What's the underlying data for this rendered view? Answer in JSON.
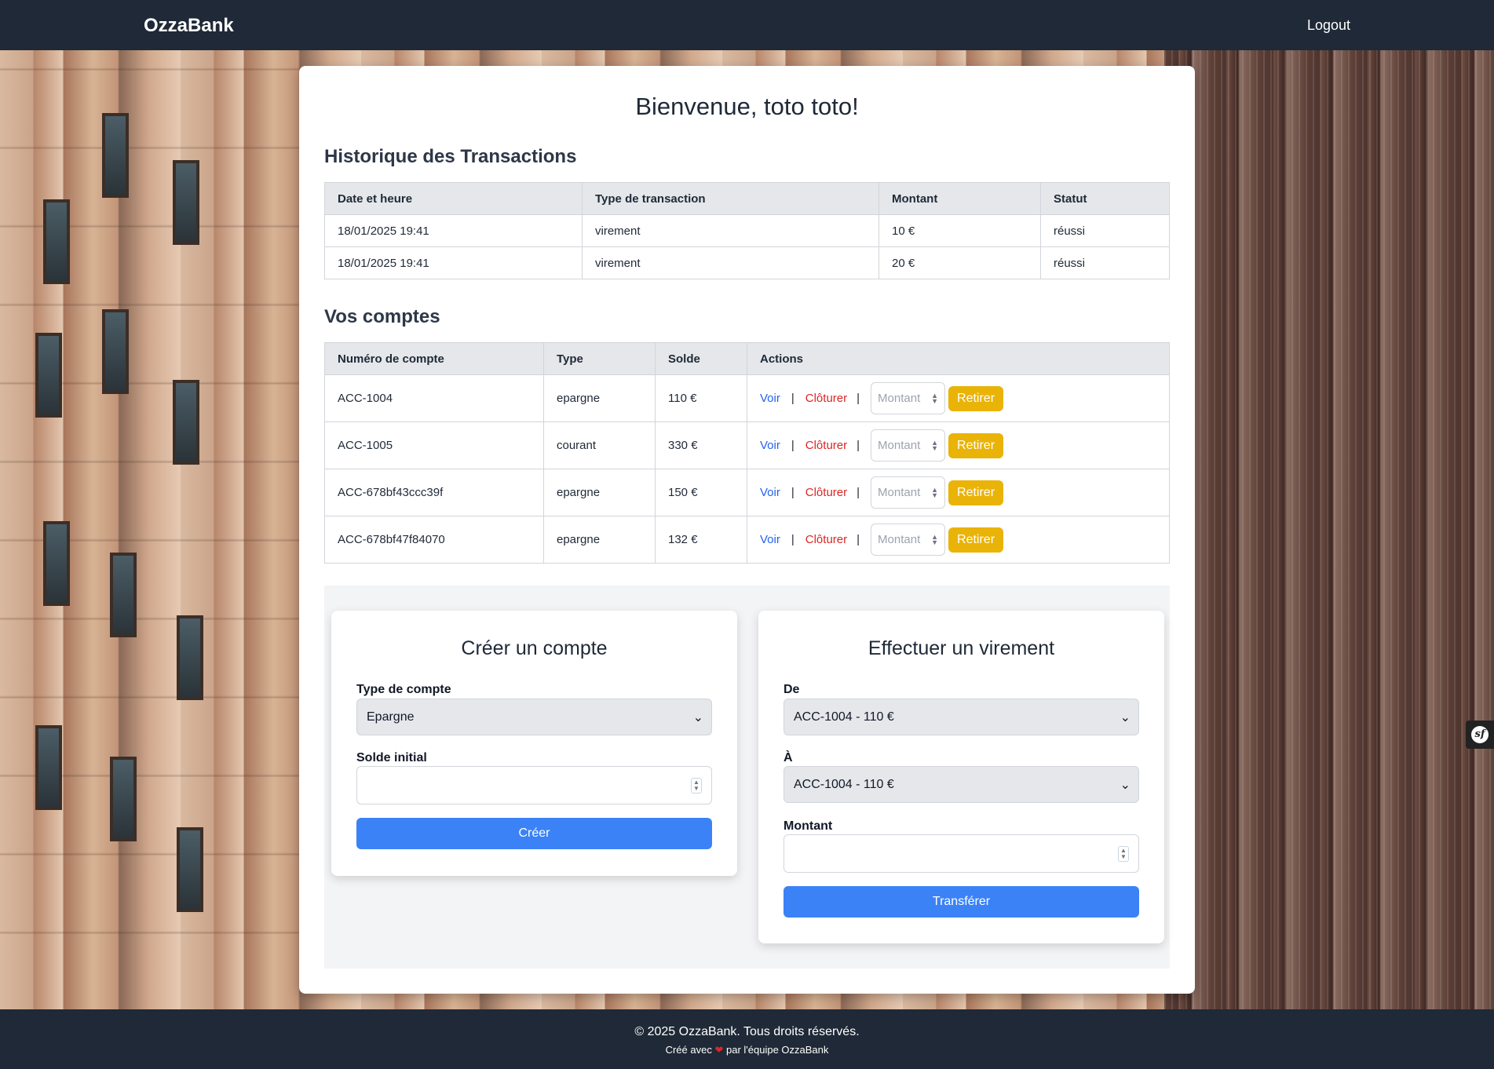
{
  "navbar": {
    "brand": "OzzaBank",
    "logout_label": "Logout"
  },
  "main": {
    "welcome": "Bienvenue, toto toto!"
  },
  "transactions": {
    "title": "Historique des Transactions",
    "headers": [
      "Date et heure",
      "Type de transaction",
      "Montant",
      "Statut"
    ],
    "rows": [
      {
        "date": "18/01/2025 19:41",
        "type": "virement",
        "amount": "10 €",
        "status": "réussi"
      },
      {
        "date": "18/01/2025 19:41",
        "type": "virement",
        "amount": "20 €",
        "status": "réussi"
      }
    ]
  },
  "accounts": {
    "title": "Vos comptes",
    "headers": [
      "Numéro de compte",
      "Type",
      "Solde",
      "Actions"
    ],
    "view_label": "Voir",
    "close_label": "Clôturer",
    "amount_placeholder": "Montant",
    "withdraw_label": "Retirer",
    "rows": [
      {
        "number": "ACC-1004",
        "type": "epargne",
        "balance": "110 €"
      },
      {
        "number": "ACC-1005",
        "type": "courant",
        "balance": "330 €"
      },
      {
        "number": "ACC-678bf43ccc39f",
        "type": "epargne",
        "balance": "150 €"
      },
      {
        "number": "ACC-678bf47f84070",
        "type": "epargne",
        "balance": "132 €"
      }
    ]
  },
  "create_account": {
    "title": "Créer un compte",
    "type_label": "Type de compte",
    "type_value": "Epargne",
    "initial_balance_label": "Solde initial",
    "submit_label": "Créer"
  },
  "transfer": {
    "title": "Effectuer un virement",
    "from_label": "De",
    "from_value": "ACC-1004 - 110 €",
    "to_label": "À",
    "to_value": "ACC-1004 - 110 €",
    "amount_label": "Montant",
    "submit_label": "Transférer"
  },
  "footer": {
    "copyright": "© 2025 OzzaBank. Tous droits réservés.",
    "credit_before": "Créé avec",
    "credit_after": "par l'équipe OzzaBank"
  },
  "colors": {
    "navbar": "#1f2937",
    "primary_button": "#3b82f6",
    "withdraw_button": "#eab308",
    "view_link": "#2563eb",
    "close_link": "#dc2626"
  },
  "icons": [
    "symfony-toolbar-icon",
    "heart-icon",
    "chevron-down-icon"
  ]
}
